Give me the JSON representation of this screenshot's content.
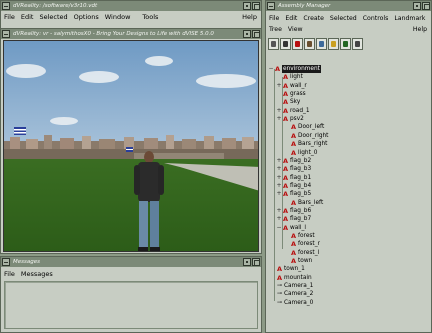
{
  "main_window": {
    "title": "dVReality: /software/v3r10.vdt",
    "menu": [
      "File",
      "Edit",
      "Selected",
      "Options",
      "Window",
      "Tools"
    ],
    "help": "Help"
  },
  "viewer_window": {
    "title": "dVReality: vr - salymithosX0 - Bring Your Designs to Life with dVISE 5.0.0"
  },
  "messages_window": {
    "title": "Messages",
    "menu": [
      "File",
      "Messages"
    ]
  },
  "assembly_window": {
    "title": "Assembly Manager",
    "menu": [
      "File",
      "Edit",
      "Create",
      "Selected",
      "Controls",
      "Landmark"
    ],
    "menu2": [
      "Tree",
      "View"
    ],
    "help": "Help",
    "tools": [
      "undo-icon",
      "assembly-icon",
      "move-icon",
      "edit-icon",
      "link-icon",
      "lock-icon",
      "visibility-icon",
      "play-icon"
    ]
  },
  "tree": {
    "root": "environment",
    "items": [
      {
        "label": "light",
        "depth": 1
      },
      {
        "label": "wall_r",
        "depth": 1,
        "expand": "+"
      },
      {
        "label": "grass",
        "depth": 1
      },
      {
        "label": "Sky",
        "depth": 1
      },
      {
        "label": "road_1",
        "depth": 1,
        "expand": "+"
      },
      {
        "label": "psv2",
        "depth": 1,
        "expand": "+"
      },
      {
        "label": "Door_left",
        "depth": 2
      },
      {
        "label": "Door_right",
        "depth": 2
      },
      {
        "label": "Bars_right",
        "depth": 2
      },
      {
        "label": "light_0",
        "depth": 2
      },
      {
        "label": "flag_b2",
        "depth": 1,
        "expand": "+"
      },
      {
        "label": "flag_b3",
        "depth": 1,
        "expand": "+"
      },
      {
        "label": "flag_b1",
        "depth": 1,
        "expand": "+"
      },
      {
        "label": "flag_b4",
        "depth": 1,
        "expand": "+"
      },
      {
        "label": "flag_b5",
        "depth": 1,
        "expand": "+"
      },
      {
        "label": "Bars_left",
        "depth": 2
      },
      {
        "label": "flag_b6",
        "depth": 1,
        "expand": "+"
      },
      {
        "label": "flag_b7",
        "depth": 1,
        "expand": "+"
      },
      {
        "label": "wall_l",
        "depth": 1,
        "expand": "-"
      },
      {
        "label": "forest",
        "depth": 2
      },
      {
        "label": "forest_r",
        "depth": 2
      },
      {
        "label": "forest_l",
        "depth": 2
      },
      {
        "label": "town",
        "depth": 2
      },
      {
        "label": "town_1",
        "depth": 0
      },
      {
        "label": "mountain",
        "depth": 0
      },
      {
        "label": "Camera_1",
        "depth": 0,
        "camera": true
      },
      {
        "label": "Camera_2",
        "depth": 0,
        "camera": true
      },
      {
        "label": "Camera_0",
        "depth": 0,
        "camera": true
      }
    ]
  },
  "colors": {
    "node": "#b81010",
    "sky": "#7fa6c9",
    "grass": "#2f6b1e"
  }
}
